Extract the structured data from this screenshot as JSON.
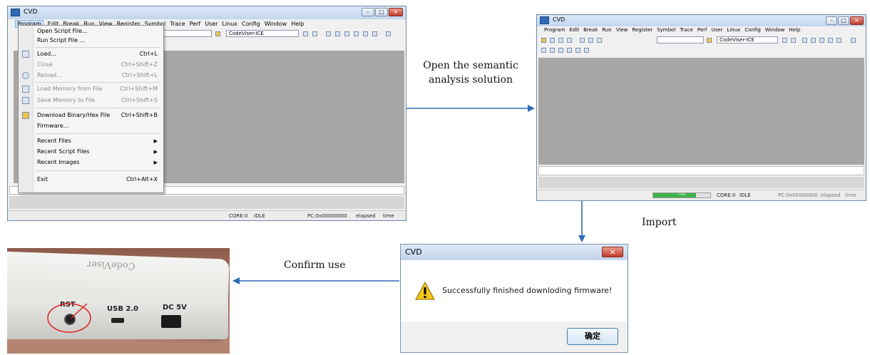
{
  "colors": {
    "arrow": "#2a6db5",
    "workspace": "#a6a6a6",
    "menu_highlight": "#cce4f7"
  },
  "steps": {
    "open": "Open the semantic\nanalysis solution",
    "import": "Import",
    "confirm": "Confirm use"
  },
  "cvd_window": {
    "title": "CVD",
    "menus": [
      "Program",
      "Edit",
      "Break",
      "Run",
      "View",
      "Register",
      "Symbol",
      "Trace",
      "Perf",
      "User",
      "Linux",
      "Config",
      "Window",
      "Help"
    ],
    "target_combo": "CodeViser-ICE",
    "status": {
      "core": "CORE:0",
      "state": "IDLE",
      "pc": "PC:0x00000000",
      "elapsed": "elapsed",
      "time": "time"
    }
  },
  "program_menu": {
    "items": [
      {
        "label": "Open Script File...",
        "shortcut": "",
        "disabled": false
      },
      {
        "label": "Run Script File ...",
        "shortcut": "",
        "disabled": false
      },
      {
        "label": "Load...",
        "shortcut": "Ctrl+L",
        "disabled": false
      },
      {
        "label": "Close",
        "shortcut": "Ctrl+Shift+Z",
        "disabled": true
      },
      {
        "label": "Reload...",
        "shortcut": "Ctrl+Shift+L",
        "disabled": true
      },
      {
        "label": "Load Memory from File",
        "shortcut": "Ctrl+Shift+M",
        "disabled": true
      },
      {
        "label": "Save Memory to File",
        "shortcut": "Ctrl+Shift+S",
        "disabled": true
      },
      {
        "label": "Download Binary/Hex File",
        "shortcut": "Ctrl+Shift+B",
        "disabled": false
      },
      {
        "label": "Firmware...",
        "shortcut": "",
        "disabled": false
      },
      {
        "label": "Recent Files",
        "shortcut": "",
        "disabled": false
      },
      {
        "label": "Recent Script Files",
        "shortcut": "",
        "disabled": false
      },
      {
        "label": "Recent Images",
        "shortcut": "",
        "disabled": false
      },
      {
        "label": "Exit",
        "shortcut": "Ctrl+Alt+X",
        "disabled": false
      }
    ]
  },
  "cvd_window_right": {
    "title": "CVD",
    "target_combo": "CodeViser-ICE",
    "progress_percent": 75,
    "progress_label": "75%",
    "status": {
      "core": "CORE:0",
      "state": "IDLE",
      "pc": "PC:0x00000000",
      "elapsed": "elapsed",
      "time": "time"
    }
  },
  "dialog": {
    "title": "CVD",
    "message": "Successfully finished downloding firmware!",
    "ok_label": "确定",
    "icon": "warning-icon"
  },
  "device": {
    "brand": "CodeViser",
    "ports": [
      "RST",
      "USB 2.0",
      "DC 5V"
    ]
  }
}
